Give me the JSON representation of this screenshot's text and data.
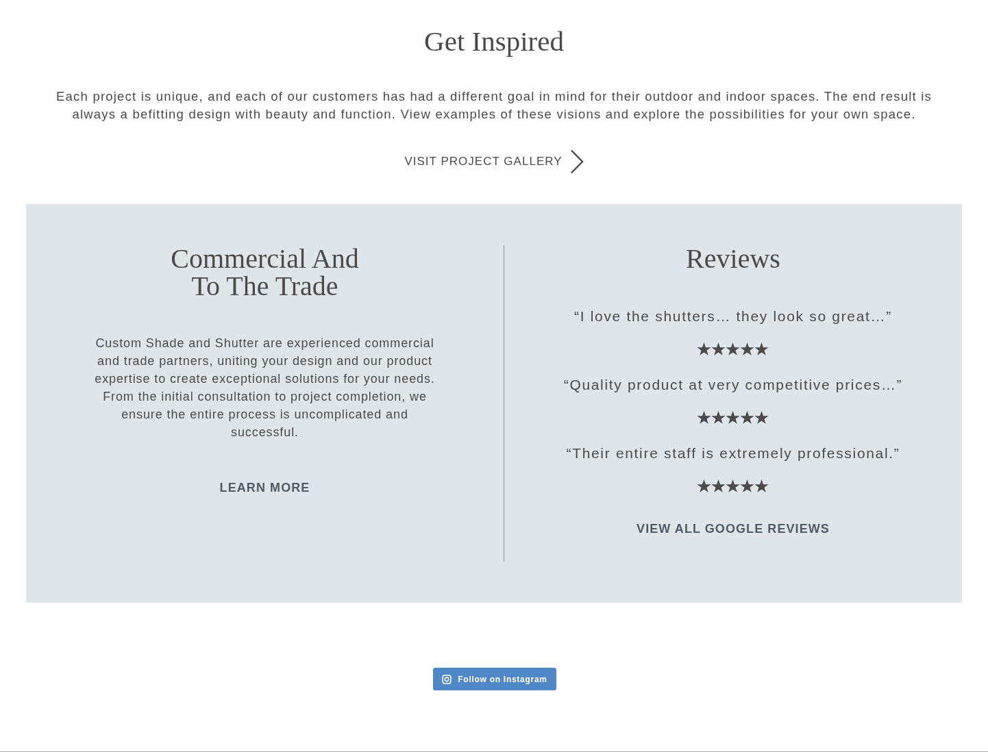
{
  "inspire": {
    "title": "Get Inspired",
    "body": "Each project is unique, and each of our customers has had a different goal in mind for their outdoor and indoor spaces. The end result is always a befitting design with beauty and function. View examples of these visions and explore the possibilities for your own space.",
    "link": "VISIT PROJECT GALLERY"
  },
  "commercial": {
    "title": "Commercial And To The Trade",
    "body": "Custom Shade and Shutter are experienced commercial and trade partners, uniting your design and our product expertise to create exceptional solutions for your needs. From the initial consultation to project completion, we ensure the entire process is uncomplicated and successful.",
    "link": "LEARN MORE"
  },
  "reviews": {
    "title": "Reviews",
    "items": [
      {
        "quote": "“I love the shutters… they look so great…”",
        "stars": 5
      },
      {
        "quote": "“Quality product at very competitive prices…”",
        "stars": 5
      },
      {
        "quote": "“Their entire staff is extremely professional.”",
        "stars": 5
      }
    ],
    "link": "VIEW ALL GOOGLE REVIEWS"
  },
  "instagram_button": {
    "label": "Follow on Instagram"
  }
}
